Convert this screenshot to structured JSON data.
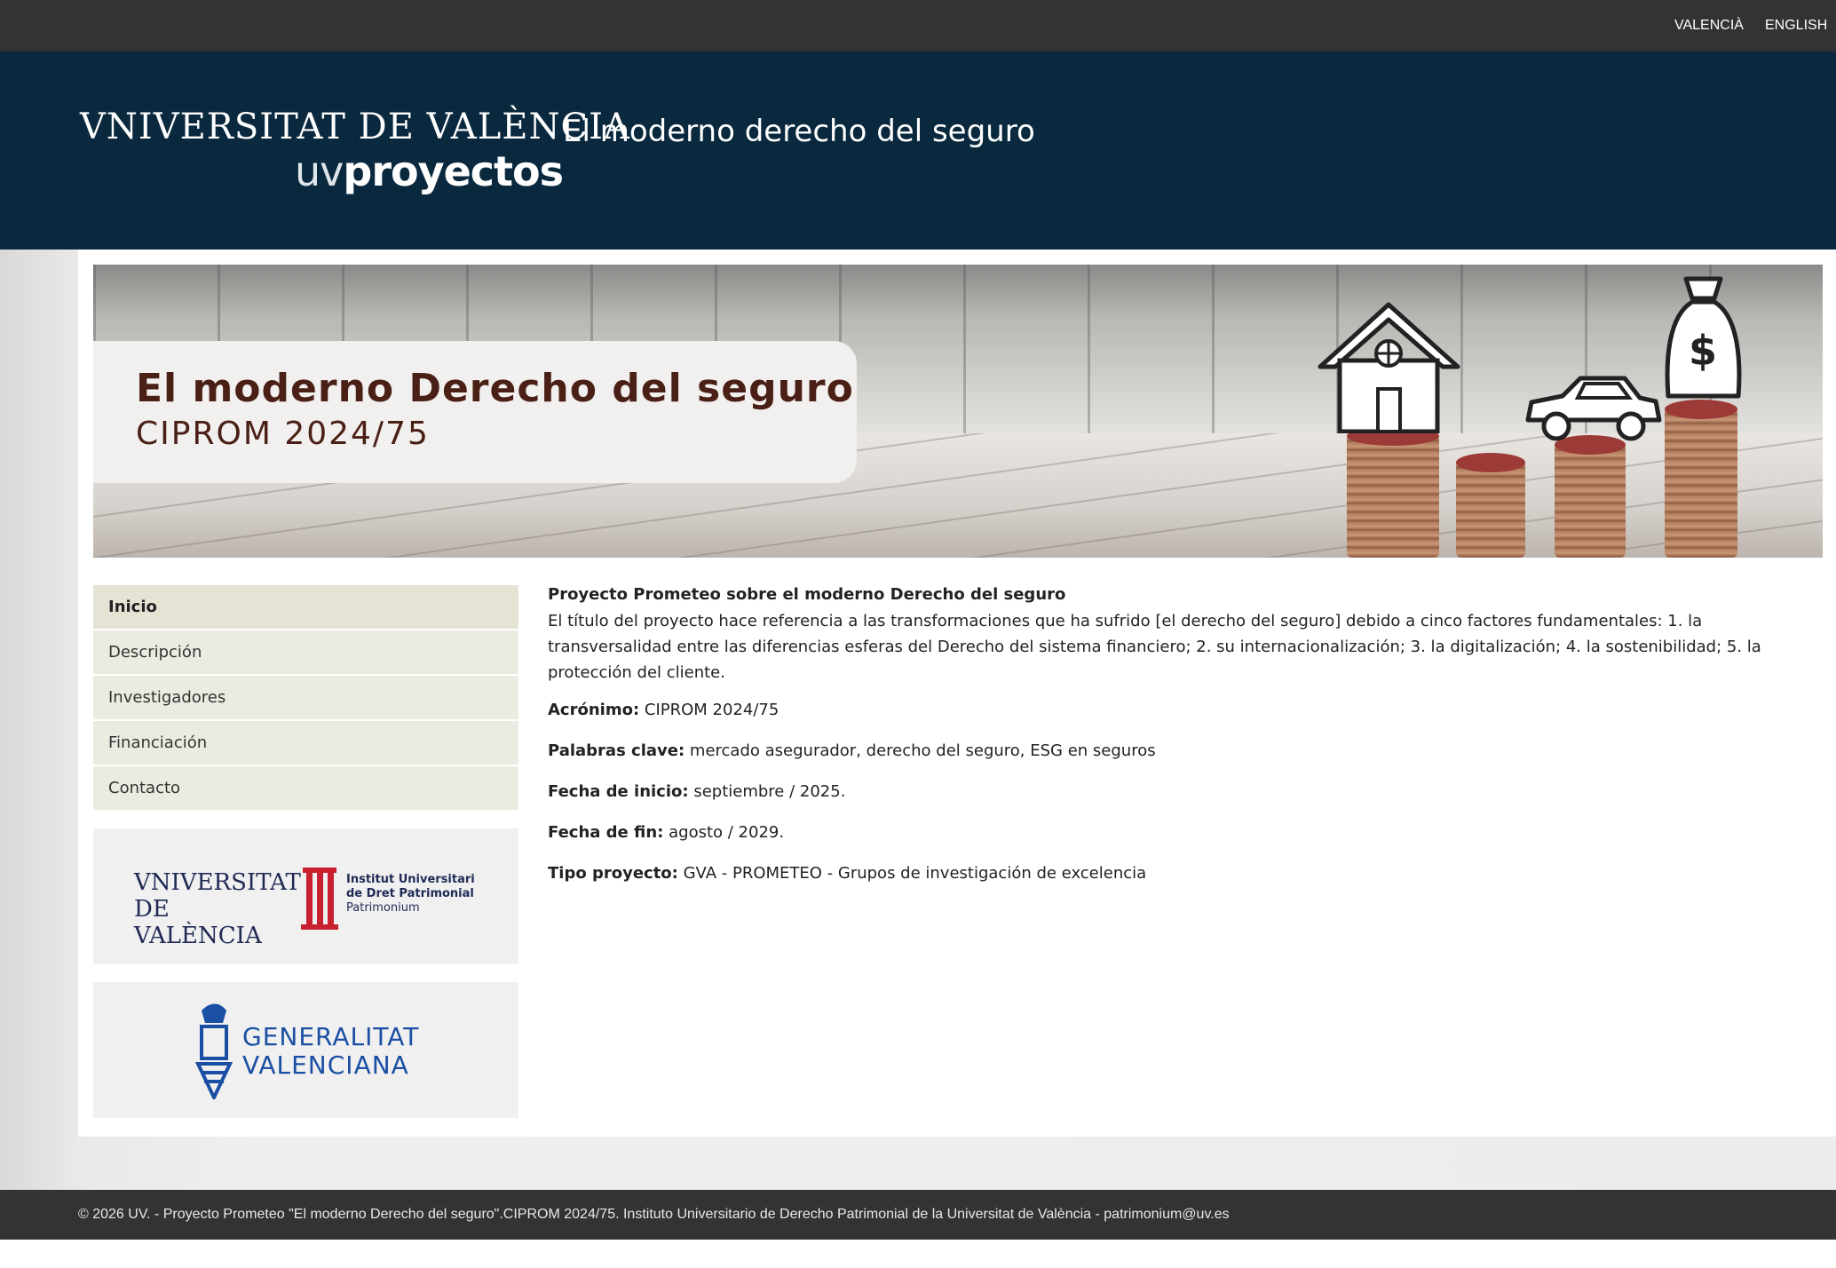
{
  "topbar": {
    "lang_valencia": "VALENCIÀ",
    "lang_english": "ENGLISH"
  },
  "header": {
    "logo_university": "VNIVERSITAT DE VALÈNCIA",
    "logo_uv": "uv",
    "logo_proyectos": "proyectos",
    "site_title": "El moderno derecho del seguro"
  },
  "banner": {
    "title": "El moderno Derecho del seguro",
    "subtitle": "CIPROM 2024/75",
    "icons": [
      "house-icon",
      "car-icon",
      "money-bag-icon",
      "coin-stack-icon"
    ]
  },
  "menu": {
    "items": [
      {
        "label": "Inicio",
        "active": true
      },
      {
        "label": "Descripción",
        "active": false
      },
      {
        "label": "Investigadores",
        "active": false
      },
      {
        "label": "Financiación",
        "active": false
      },
      {
        "label": "Contacto",
        "active": false
      }
    ]
  },
  "partners": {
    "uv_logo": "VNIVERSITAT DE VALÈNCIA",
    "institute_line1": "Institut Universitari",
    "institute_line2": "de Dret Patrimonial",
    "institute_line3": "Patrimonium",
    "gva_line1": "GENERALITAT",
    "gva_line2": "VALENCIANA"
  },
  "main": {
    "heading": "Proyecto Prometeo sobre el moderno Derecho del seguro",
    "description": "El título del proyecto hace referencia a las transformaciones que ha sufrido [el derecho del seguro] debido a cinco factores fundamentales: 1. la transversalidad entre las diferencias esferas del Derecho del  sistema financiero; 2. su internacionalización; 3. la digitalización; 4. la sostenibilidad; 5. la protección del cliente.",
    "fields": [
      {
        "label": "Acrónimo:",
        "value": "CIPROM 2024/75"
      },
      {
        "label": "Palabras clave:",
        "value": "mercado asegurador, derecho del seguro, ESG en seguros"
      },
      {
        "label": "Fecha de inicio:",
        "value": "septiembre / 2025."
      },
      {
        "label": "Fecha de fin:",
        "value": "agosto / 2029."
      },
      {
        "label": "Tipo proyecto:",
        "value": "GVA - PROMETEO - Grupos de investigación de excelencia"
      }
    ]
  },
  "footer": {
    "text": "© 2026 UV. - Proyecto Prometeo \"El moderno Derecho del seguro\".CIPROM 2024/75. Instituto Universitario de Derecho Patrimonial de la Universitat de València - patrimonium@uv.es"
  },
  "colors": {
    "topbar": "#333333",
    "header": "#0a293e",
    "menu_bg": "#ecebe1",
    "menu_active": "#e5e3d4",
    "banner_text": "#4a1f16"
  }
}
